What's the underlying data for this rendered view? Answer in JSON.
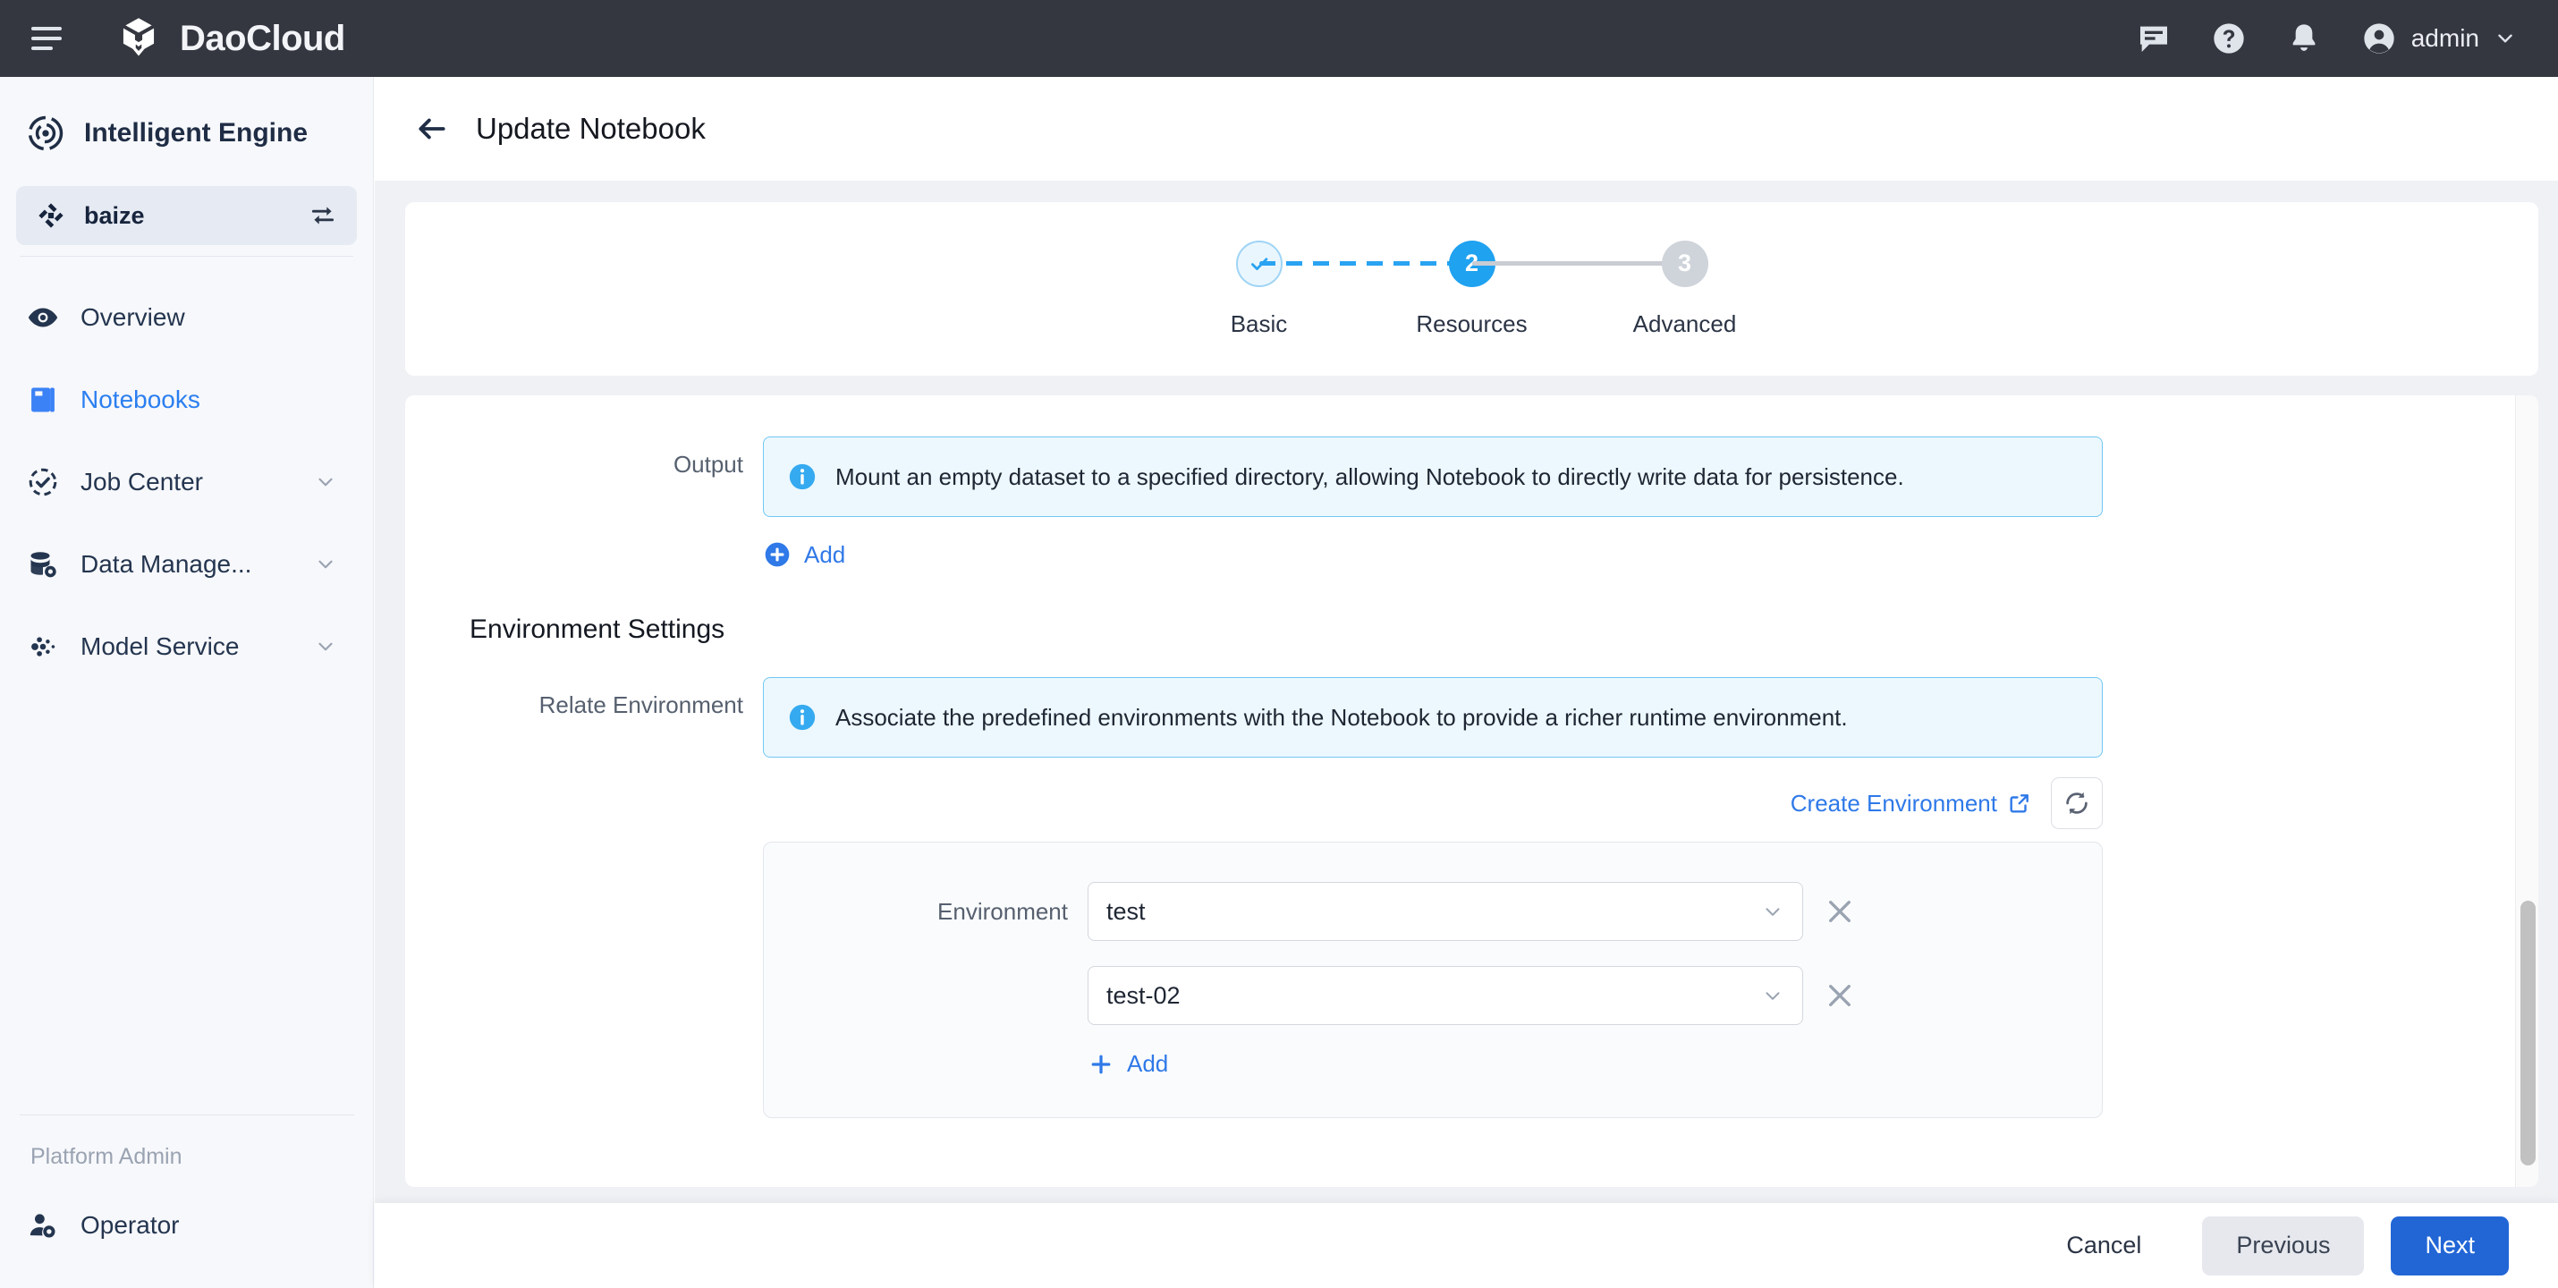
{
  "topbar": {
    "menu_icon": "hamburger-icon",
    "brand": "DaoCloud",
    "icons": [
      "chat-icon",
      "help-icon",
      "bell-icon"
    ],
    "user": "admin"
  },
  "sidebar": {
    "product_title": "Intelligent Engine",
    "workspace": {
      "label": "baize",
      "sync_icon": "sync-icon"
    },
    "items": [
      {
        "label": "Overview",
        "icon": "eye-icon",
        "active": false,
        "expandable": false
      },
      {
        "label": "Notebooks",
        "icon": "book-icon",
        "active": true,
        "expandable": false
      },
      {
        "label": "Job Center",
        "icon": "task-check-icon",
        "active": false,
        "expandable": true
      },
      {
        "label": "Data Manage...",
        "icon": "database-gear-icon",
        "active": false,
        "expandable": true
      },
      {
        "label": "Model Service",
        "icon": "model-nodes-icon",
        "active": false,
        "expandable": true
      }
    ],
    "footer_group_label": "Platform Admin",
    "footer_items": [
      {
        "label": "Operator",
        "icon": "user-gear-icon"
      }
    ]
  },
  "page": {
    "back_icon": "back-arrow-icon",
    "title": "Update Notebook"
  },
  "stepper": {
    "steps": [
      {
        "num": "1",
        "label": "Basic",
        "state": "done",
        "glyph": "check-icon"
      },
      {
        "num": "2",
        "label": "Resources",
        "state": "active"
      },
      {
        "num": "3",
        "label": "Advanced",
        "state": "todo"
      }
    ]
  },
  "form": {
    "output": {
      "label": "Output",
      "info_icon": "info-icon",
      "info_text": "Mount an empty dataset to a specified directory, allowing Notebook to directly write data for persistence.",
      "add_label": "Add",
      "add_icon": "plus-circle-icon"
    },
    "environment_settings": {
      "section_title": "Environment Settings",
      "relate_label": "Relate Environment",
      "info_icon": "info-icon",
      "info_text": "Associate the predefined environments with the Notebook to provide a richer runtime environment.",
      "create_link": "Create Environment",
      "create_link_icon": "external-link-icon",
      "refresh_icon": "refresh-icon",
      "env_row_label": "Environment",
      "selects": [
        {
          "value": "test",
          "caret": "chevron-down-icon",
          "remove": "close-icon"
        },
        {
          "value": "test-02",
          "caret": "chevron-down-icon",
          "remove": "close-icon"
        }
      ],
      "add_label": "Add",
      "add_icon": "plus-icon"
    }
  },
  "footer": {
    "cancel": "Cancel",
    "previous": "Previous",
    "next": "Next"
  },
  "colors": {
    "topbar_bg": "#343740",
    "accent_blue": "#2f79e8",
    "primary_button": "#2266d6",
    "info_blue": "#1fa2f0",
    "sidebar_bg": "#f7f8fb",
    "content_bg": "#eff1f5"
  }
}
